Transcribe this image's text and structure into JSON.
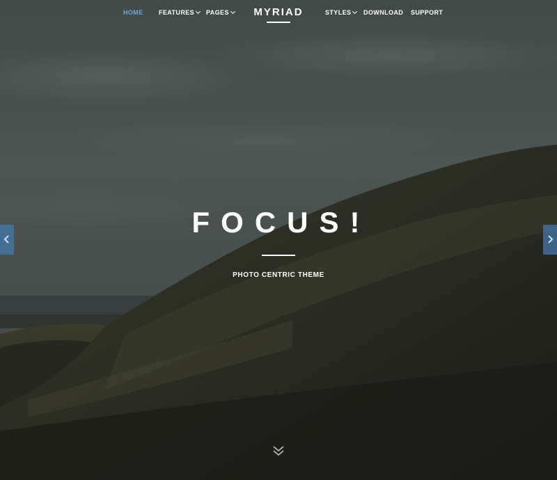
{
  "nav": {
    "left_items": [
      {
        "label": "HOME",
        "active": true
      },
      {
        "label": "FEATURES",
        "dropdown": true
      },
      {
        "label": "PAGES",
        "dropdown": true
      }
    ],
    "logo": "MYRIAD",
    "right_items": [
      {
        "label": "STYLES",
        "dropdown": true
      },
      {
        "label": "DOWNLOAD"
      },
      {
        "label": "SUPPORT"
      }
    ]
  },
  "hero": {
    "headline": "FOCUS!",
    "tagline": "PHOTO CENTRIC THEME"
  },
  "colors": {
    "active_nav": "#6fa8dc",
    "arrow_bg": "#4678aa",
    "text": "#ffffff"
  },
  "icons": {
    "prev": "chevron-left-icon",
    "next": "chevron-right-icon",
    "scroll": "double-chevron-down-icon"
  }
}
